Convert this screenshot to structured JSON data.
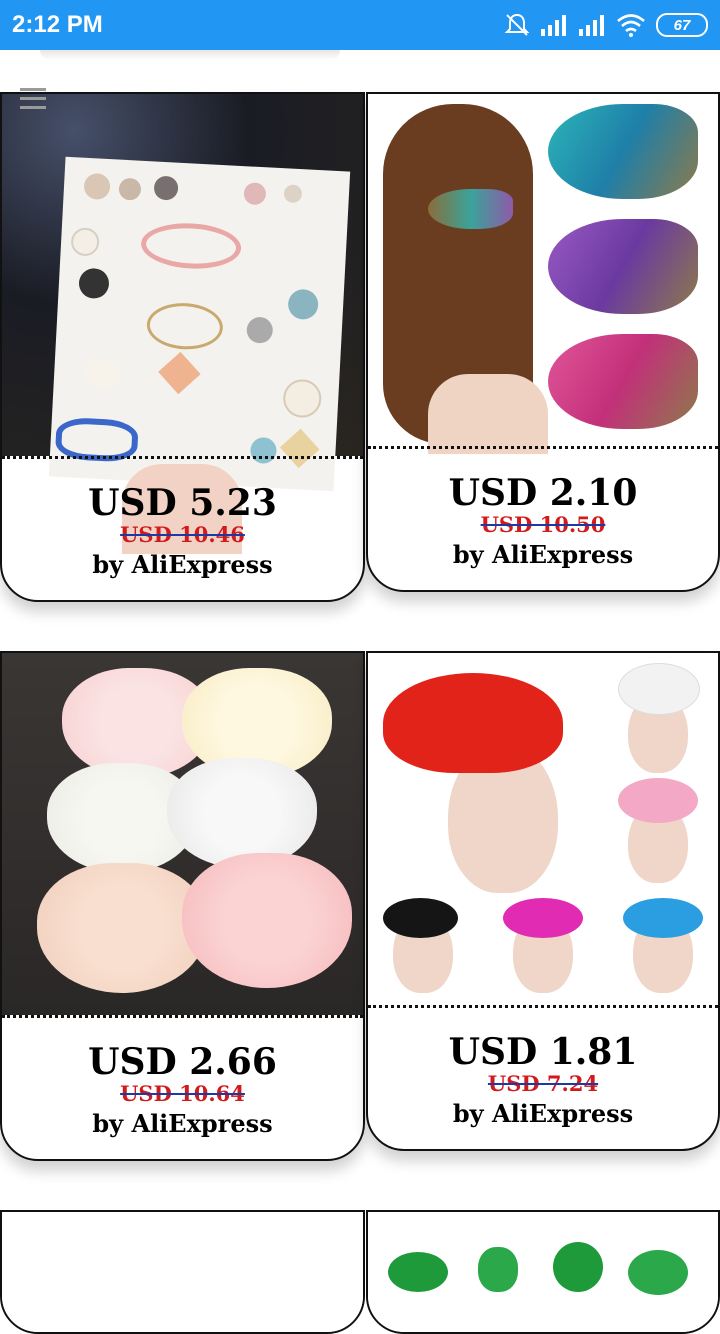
{
  "status_bar": {
    "time": "2:12 PM",
    "battery": "67"
  },
  "colors": {
    "status_bar": "#2196F3",
    "old_price": "#d11a1a",
    "strike": "#1a3aa8"
  },
  "products": [
    {
      "price": "USD 5.23",
      "old_price": "USD 10.46",
      "seller": "by AliExpress",
      "image": "hair-pins-set-image"
    },
    {
      "price": "USD 2.10",
      "old_price": "USD 10.50",
      "seller": "by AliExpress",
      "image": "peacock-hair-clip-image"
    },
    {
      "price": "USD 2.66",
      "old_price": "USD 10.64",
      "seller": "by AliExpress",
      "image": "heart-print-bows-image"
    },
    {
      "price": "USD 1.81",
      "old_price": "USD 7.24",
      "seller": "by AliExpress",
      "image": "fascinator-hats-image"
    }
  ]
}
